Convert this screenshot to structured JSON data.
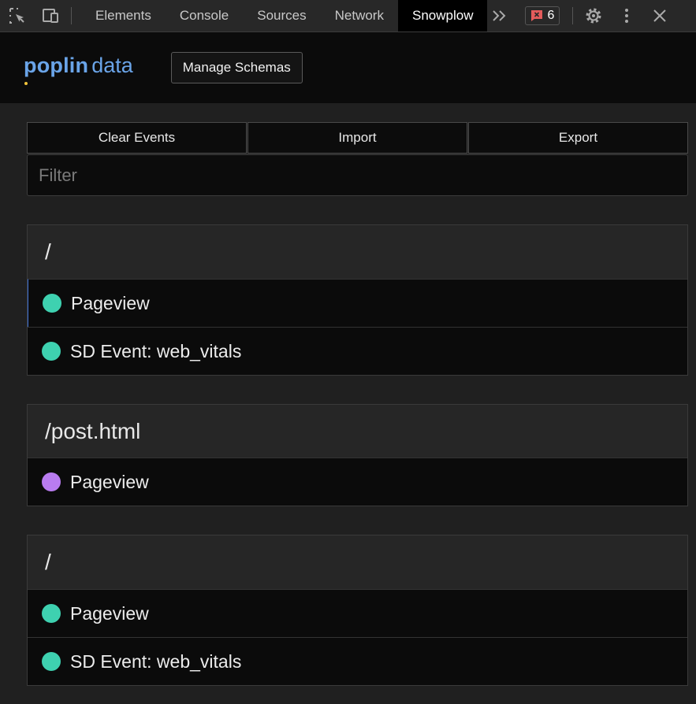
{
  "devtools": {
    "tabs": [
      {
        "label": "Elements"
      },
      {
        "label": "Console"
      },
      {
        "label": "Sources"
      },
      {
        "label": "Network"
      },
      {
        "label": "Snowplow"
      }
    ],
    "active_tab": "Snowplow",
    "issues_count": "6"
  },
  "header": {
    "logo_primary": "poplin",
    "logo_secondary": "data",
    "manage_schemas_label": "Manage Schemas"
  },
  "toolbar": {
    "clear_label": "Clear Events",
    "import_label": "Import",
    "export_label": "Export",
    "filter_placeholder": "Filter"
  },
  "colors": {
    "event_green": "#3ed1b0",
    "event_purple": "#b97cf0",
    "logo_blue": "#6aa4e8"
  },
  "groups": [
    {
      "path": "/",
      "events": [
        {
          "label": "Pageview",
          "color": "#3ed1b0"
        },
        {
          "label": "SD Event: web_vitals",
          "color": "#3ed1b0"
        }
      ]
    },
    {
      "path": "/post.html",
      "events": [
        {
          "label": "Pageview",
          "color": "#b97cf0"
        }
      ]
    },
    {
      "path": "/",
      "events": [
        {
          "label": "Pageview",
          "color": "#3ed1b0"
        },
        {
          "label": "SD Event: web_vitals",
          "color": "#3ed1b0"
        }
      ]
    }
  ]
}
